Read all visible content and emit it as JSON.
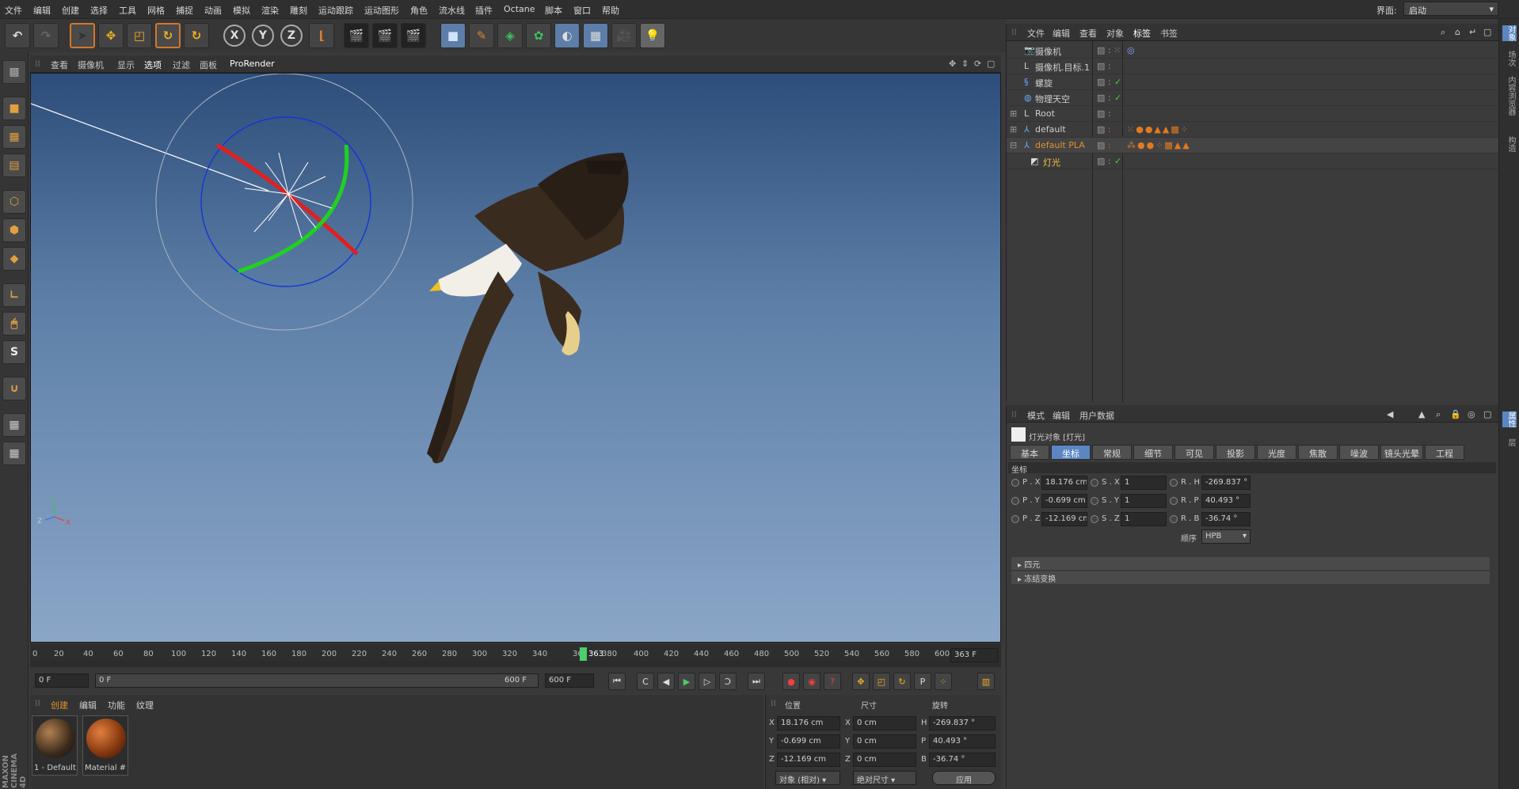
{
  "menu": [
    "文件",
    "编辑",
    "创建",
    "选择",
    "工具",
    "网格",
    "捕捉",
    "动画",
    "模拟",
    "渲染",
    "雕刻",
    "运动跟踪",
    "运动图形",
    "角色",
    "流水线",
    "插件",
    "Octane",
    "脚本",
    "窗口",
    "帮助"
  ],
  "layout": {
    "label": "界面:",
    "value": "启动"
  },
  "viewport": {
    "menu": [
      "查看",
      "摄像机",
      "显示",
      "选项",
      "过滤",
      "面板",
      "ProRender"
    ]
  },
  "timeline": {
    "ticks": [
      "0",
      "20",
      "40",
      "60",
      "80",
      "100",
      "120",
      "140",
      "160",
      "180",
      "200",
      "220",
      "240",
      "260",
      "280",
      "300",
      "320",
      "340",
      "36",
      "363",
      "380",
      "400",
      "420",
      "440",
      "460",
      "480",
      "500",
      "520",
      "540",
      "560",
      "580",
      "600"
    ],
    "current": "363 F"
  },
  "transport": {
    "start": "0 F",
    "range_start": "0 F",
    "range_end": "600 F",
    "end": "600 F"
  },
  "materials": {
    "menu": [
      "创建",
      "编辑",
      "功能",
      "纹理"
    ],
    "items": [
      "1 - Default",
      "Material #"
    ]
  },
  "coords": {
    "headers": [
      "位置",
      "尺寸",
      "旋转"
    ],
    "rows": [
      {
        "axis": "X",
        "pos": "18.176 cm",
        "size": "0 cm",
        "rlabel": "H",
        "rot": "-269.837 °"
      },
      {
        "axis": "Y",
        "pos": "-0.699 cm",
        "size": "0 cm",
        "rlabel": "P",
        "rot": "40.493 °"
      },
      {
        "axis": "Z",
        "pos": "-12.169 cm",
        "size": "0 cm",
        "rlabel": "B",
        "rot": "-36.74 °"
      }
    ],
    "mode1": "对象 (相对)",
    "mode2": "绝对尺寸",
    "apply": "应用"
  },
  "objects": {
    "menu": [
      "文件",
      "编辑",
      "查看",
      "对象",
      "标签",
      "书签"
    ],
    "items": [
      {
        "name": "摄像机",
        "indent": 0,
        "color": "#cfcfcf"
      },
      {
        "name": "摄像机.目标.1",
        "indent": 0,
        "color": "#cfcfcf"
      },
      {
        "name": "螺旋",
        "indent": 0,
        "color": "#cfcfcf"
      },
      {
        "name": "物理天空",
        "indent": 0,
        "color": "#cfcfcf"
      },
      {
        "name": "Root",
        "indent": 0,
        "color": "#cfcfcf"
      },
      {
        "name": "default",
        "indent": 0,
        "color": "#cfcfcf"
      },
      {
        "name": "default PLA",
        "indent": 0,
        "color": "#e0902a"
      },
      {
        "name": "灯光",
        "indent": 1,
        "color": "#f0c040"
      }
    ]
  },
  "attributes": {
    "menu": [
      "模式",
      "编辑",
      "用户数据"
    ],
    "title": "灯光对象 [灯光]",
    "tabs": [
      "基本",
      "坐标",
      "常规",
      "细节",
      "可见",
      "投影",
      "光度",
      "焦散",
      "噪波",
      "镜头光晕",
      "工程"
    ],
    "section": "坐标",
    "fields": [
      {
        "p_label": "P . X",
        "p": "18.176 cm",
        "s_label": "S . X",
        "s": "1",
        "r_label": "R . H",
        "r": "-269.837 °"
      },
      {
        "p_label": "P . Y",
        "p": "-0.699 cm",
        "s_label": "S . Y",
        "s": "1",
        "r_label": "R . P",
        "r": "40.493 °"
      },
      {
        "p_label": "P . Z",
        "p": "-12.169 cm",
        "s_label": "S . Z",
        "s": "1",
        "r_label": "R . B",
        "r": "-36.74 °"
      }
    ],
    "order_label": "顺序",
    "order_value": "HPB",
    "groups": [
      "四元",
      "冻结变换"
    ]
  },
  "side_tabs": [
    "对象",
    "场次",
    "内容浏览器",
    "构造",
    "属性",
    "层"
  ],
  "brand": "MAXON CINEMA 4D"
}
